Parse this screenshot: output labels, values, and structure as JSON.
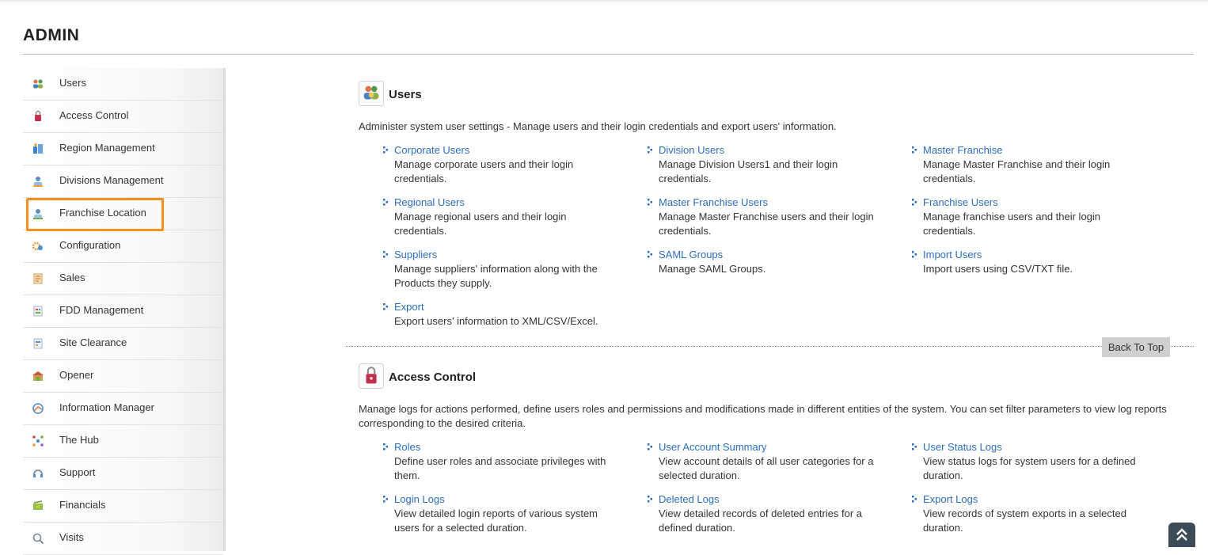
{
  "page": {
    "title": "ADMIN"
  },
  "sidebar": {
    "items": [
      {
        "label": "Users"
      },
      {
        "label": "Access Control"
      },
      {
        "label": "Region Management"
      },
      {
        "label": "Divisions Management"
      },
      {
        "label": "Franchise Location"
      },
      {
        "label": "Configuration"
      },
      {
        "label": "Sales"
      },
      {
        "label": "FDD Management"
      },
      {
        "label": "Site Clearance"
      },
      {
        "label": "Opener"
      },
      {
        "label": "Information Manager"
      },
      {
        "label": "The Hub"
      },
      {
        "label": "Support"
      },
      {
        "label": "Financials"
      },
      {
        "label": "Visits"
      }
    ],
    "highlight_color": "#f5901e"
  },
  "sections": {
    "users": {
      "title": "Users",
      "description": "Administer system user settings - Manage users and their login credentials and export users' information.",
      "links": [
        {
          "label": "Corporate Users",
          "desc": "Manage corporate users and their login credentials."
        },
        {
          "label": "Division Users",
          "desc": "Manage Division Users1 and their login credentials."
        },
        {
          "label": "Master Franchise",
          "desc": "Manage Master Franchise and their login credentials."
        },
        {
          "label": "Regional Users",
          "desc": "Manage regional users and their login credentials."
        },
        {
          "label": "Master Franchise Users",
          "desc": "Manage Master Franchise users and their login credentials."
        },
        {
          "label": "Franchise Users",
          "desc": "Manage franchise users and their login credentials."
        },
        {
          "label": "Suppliers",
          "desc": "Manage suppliers' information along with the Products they supply."
        },
        {
          "label": "SAML Groups",
          "desc": "Manage SAML Groups."
        },
        {
          "label": "Import Users",
          "desc": "Import users using CSV/TXT file."
        },
        {
          "label": "Export",
          "desc": "Export users' information to XML/CSV/Excel."
        }
      ]
    },
    "access_control": {
      "title": "Access Control",
      "description": "Manage logs for actions performed, define users roles and permissions and modifications made in different entities of the system. You can set filter parameters to view log reports corresponding to the desired criteria.",
      "links": [
        {
          "label": "Roles",
          "desc": "Define user roles and associate privileges with them."
        },
        {
          "label": "User Account Summary",
          "desc": "View account details of all user categories for a selected duration."
        },
        {
          "label": "User Status Logs",
          "desc": "View status logs for system users for a defined duration."
        },
        {
          "label": "Login Logs",
          "desc": "View detailed login reports of various system users for a selected duration."
        },
        {
          "label": "Deleted Logs",
          "desc": "View detailed records of deleted entries for a defined duration."
        },
        {
          "label": "Export Logs",
          "desc": "View records of system exports in a selected duration."
        }
      ]
    }
  },
  "back_to_top": {
    "label": "Back To Top"
  },
  "colors": {
    "link": "#2a6ebb",
    "accent": "#f5901e",
    "scroll_button": "#3d4a57"
  }
}
